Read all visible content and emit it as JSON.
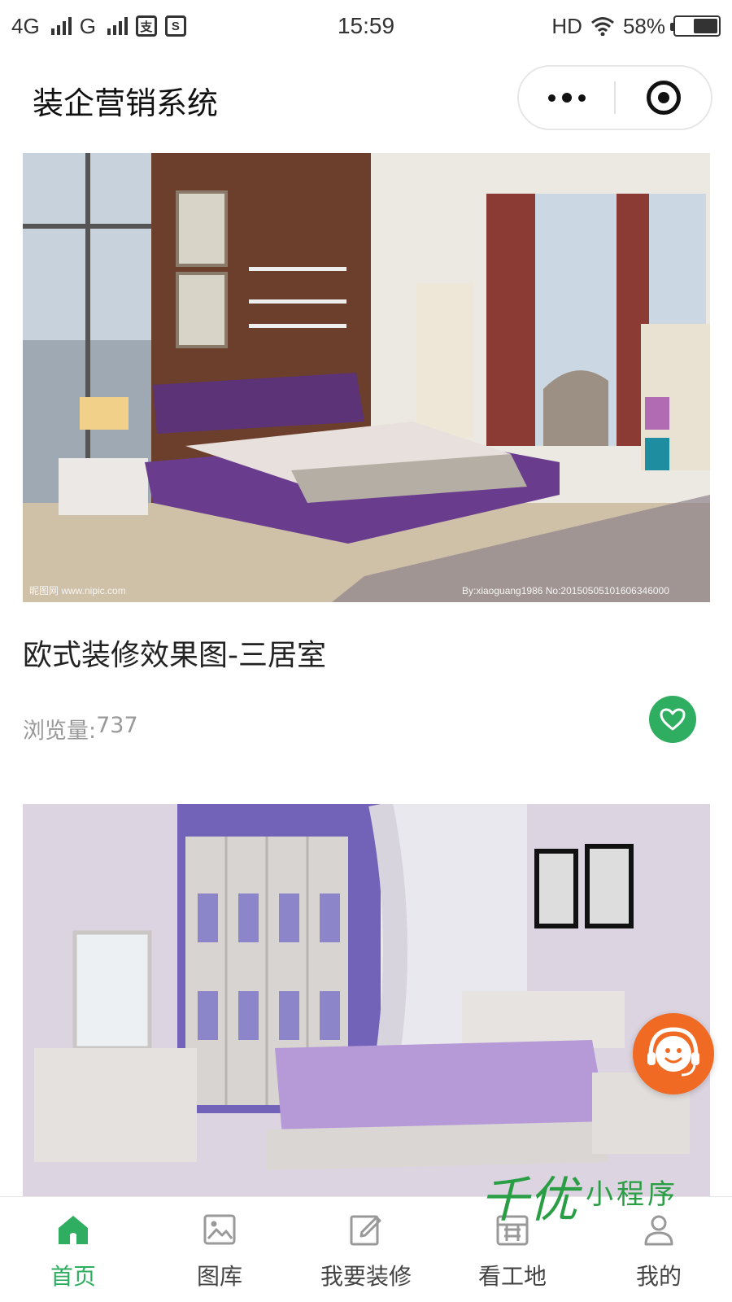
{
  "status_bar": {
    "network_1": "4G",
    "network_2": "G",
    "badge_1": "支",
    "badge_2": "S",
    "time": "15:59",
    "hd": "HD",
    "battery": "58%",
    "battery_level": 0.58
  },
  "nav": {
    "title": "装企营销系统"
  },
  "feed": [
    {
      "title": "欧式装修效果图-三居室",
      "views_label": "浏览量:",
      "views": "737",
      "image_watermark_left": "昵图网 www.nipic.com",
      "image_watermark_right": "By:xiaoguang1986 No:20150505101606346000"
    },
    {
      "title": "",
      "views_label": "",
      "views": ""
    }
  ],
  "watermark": {
    "big": "千优",
    "small": "小程序"
  },
  "tabs": [
    {
      "label": "首页",
      "icon": "home-icon",
      "active": true
    },
    {
      "label": "图库",
      "icon": "gallery-icon",
      "active": false
    },
    {
      "label": "我要装修",
      "icon": "edit-icon",
      "active": false
    },
    {
      "label": "看工地",
      "icon": "construction-icon",
      "active": false
    },
    {
      "label": "我的",
      "icon": "user-icon",
      "active": false
    }
  ],
  "colors": {
    "accent": "#2fae61",
    "service": "#f06a23",
    "tab_inactive": "#444444"
  }
}
